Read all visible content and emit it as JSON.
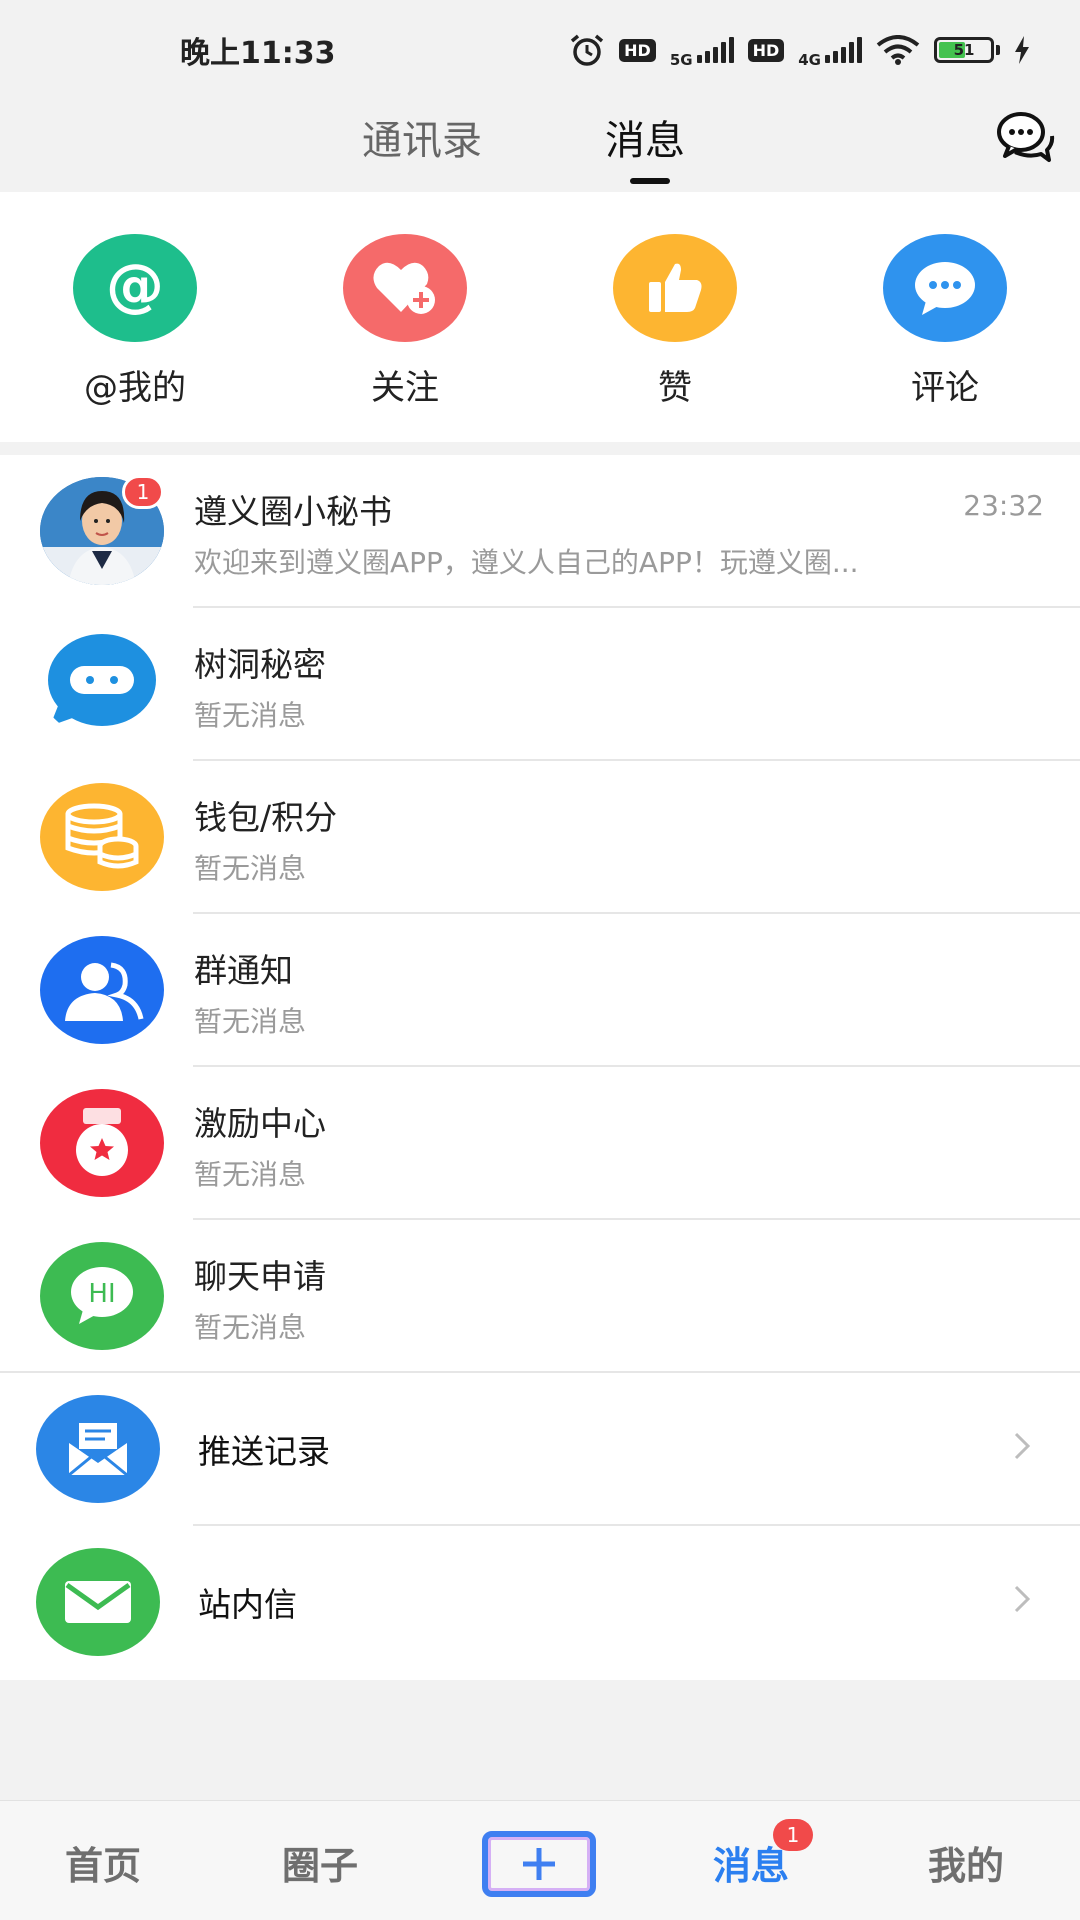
{
  "status_bar": {
    "time": "晚上11:33",
    "hd1": "HD",
    "net1": "5G",
    "hd2": "HD",
    "net2": "4G",
    "battery": "51"
  },
  "top_tabs": {
    "contacts": "通讯录",
    "messages": "消息"
  },
  "quick_actions": [
    {
      "label": "@我的",
      "color": "#1ebe8c",
      "icon": "at-icon"
    },
    {
      "label": "关注",
      "color": "#f56a6a",
      "icon": "heart-plus-icon"
    },
    {
      "label": "赞",
      "color": "#fdb531",
      "icon": "thumbs-up-icon"
    },
    {
      "label": "评论",
      "color": "#2f93ee",
      "icon": "comment-icon"
    }
  ],
  "list": [
    {
      "title": "遵义圈小秘书",
      "subtitle": "欢迎来到遵义圈APP，遵义人自己的APP！玩遵义圈...",
      "time": "23:32",
      "badge": "1",
      "icon": "avatar-icon"
    },
    {
      "title": "树洞秘密",
      "subtitle": "暂无消息",
      "icon": "speech-bubble-icon",
      "color": "#1e90e0"
    },
    {
      "title": "钱包/积分",
      "subtitle": "暂无消息",
      "icon": "coins-icon",
      "color": "#fdb531"
    },
    {
      "title": "群通知",
      "subtitle": "暂无消息",
      "icon": "group-icon",
      "color": "#1e6ef0"
    },
    {
      "title": "激励中心",
      "subtitle": "暂无消息",
      "icon": "medal-icon",
      "color": "#f02c40"
    },
    {
      "title": "聊天申请",
      "subtitle": "暂无消息",
      "icon": "hi-bubble-icon",
      "color": "#3dbb52"
    },
    {
      "title": "推送记录",
      "icon": "inbox-icon",
      "color": "#2b86e6"
    },
    {
      "title": "站内信",
      "icon": "envelope-icon",
      "color": "#3dbb52"
    }
  ],
  "bottom_nav": {
    "home": "首页",
    "circle": "圈子",
    "messages": "消息",
    "messages_badge": "1",
    "mine": "我的"
  },
  "colors": {
    "accent": "#2b7ff0",
    "badge": "#f14a4a"
  }
}
